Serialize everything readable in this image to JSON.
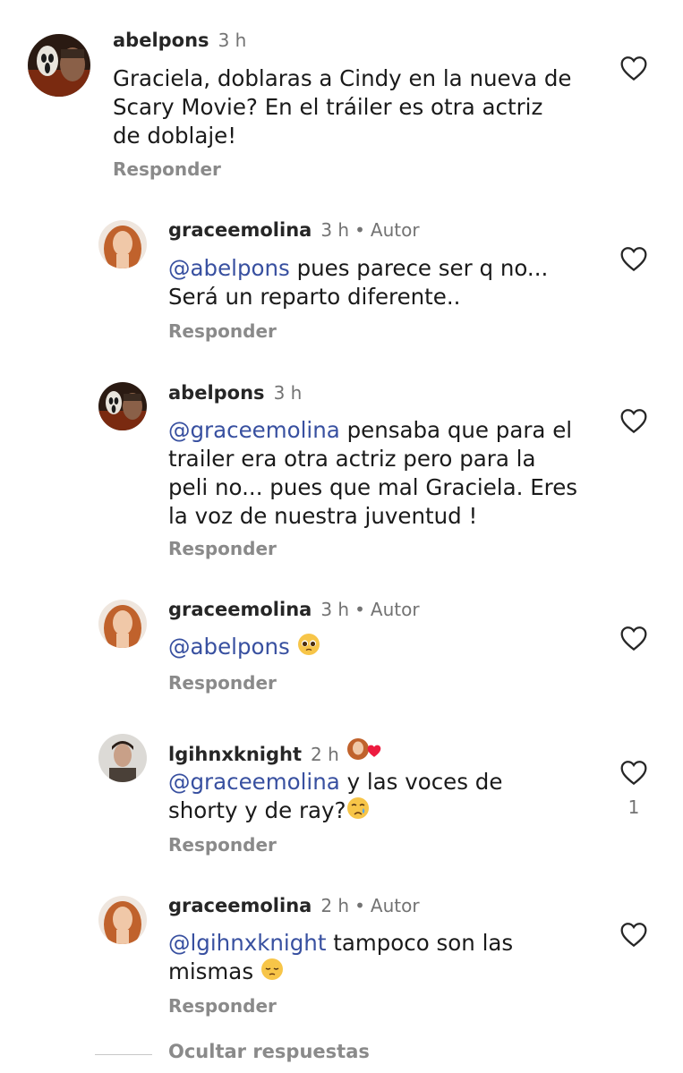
{
  "comments": [
    {
      "user": "abelpons",
      "time": "3 h",
      "author_label": "",
      "mention": "",
      "text_lines": [
        "Graciela, doblaras a Cindy en la nueva de",
        "Scary Movie? En el tráiler es otra actriz",
        "de doblaje!"
      ],
      "reply": "Responder",
      "likes": ""
    },
    {
      "user": "graceemolina",
      "time": "3 h",
      "author_label": "Autor",
      "mention": "abelpons",
      "text": "pues parece ser q no...",
      "text_line2": "Será un reparto diferente..",
      "reply": "Responder",
      "likes": ""
    },
    {
      "user": "abelpons",
      "time": "3 h",
      "author_label": "",
      "mention": "graceemolina",
      "text": "pensaba que para el",
      "text_line2": "trailer era otra actriz pero para la",
      "text_line3": "peli no... pues que mal Graciela. Eres",
      "text_line4": "la voz de nuestra juventud !",
      "reply": "Responder",
      "likes": ""
    },
    {
      "user": "graceemolina",
      "time": "3 h",
      "author_label": "Autor",
      "mention": "abelpons",
      "text": "",
      "emoji": "pleading-face",
      "reply": "Responder",
      "likes": ""
    },
    {
      "user": "lgihnxknight",
      "time": "2 h",
      "author_label": "",
      "mention": "graceemolina",
      "text": "y las voces de",
      "text_line2": "shorty y de ray?",
      "emoji": "crying-face",
      "reply": "Responder",
      "likes": "1",
      "liked_by_author": true
    },
    {
      "user": "graceemolina",
      "time": "2 h",
      "author_label": "Autor",
      "mention": "lgihnxknight",
      "text": "tampoco son las",
      "text_line2": "mismas",
      "emoji": "pensive-face",
      "reply": "Responder",
      "likes": ""
    }
  ],
  "separator": "•",
  "at_symbol": "@",
  "hide_replies": "Ocultar respuestas",
  "icons": {
    "like": "heart-outline-icon",
    "badge_heart": "heart-filled-icon"
  },
  "colors": {
    "mention": "#3850a0",
    "muted": "#737373",
    "heart_red": "#ed1b3f"
  }
}
